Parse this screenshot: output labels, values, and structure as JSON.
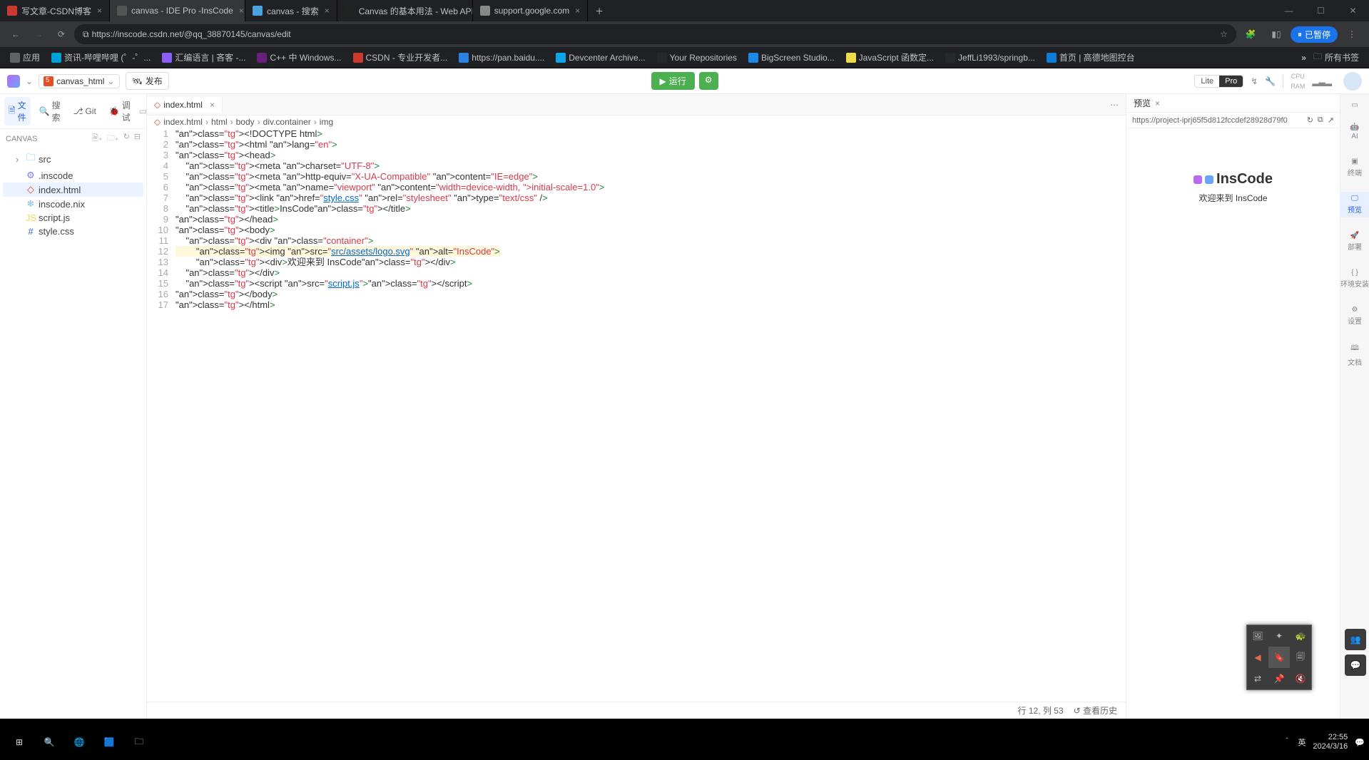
{
  "browser": {
    "tabs": [
      {
        "label": "写文章-CSDN博客",
        "fav": "#cc3a2f"
      },
      {
        "label": "canvas - IDE Pro -InsCode",
        "fav": "#555",
        "active": true
      },
      {
        "label": "canvas - 搜索",
        "fav": "#4aa3df"
      },
      {
        "label": "Canvas 的基本用法 - Web API",
        "fav": "#222"
      },
      {
        "label": "support.google.com",
        "fav": "#888"
      }
    ],
    "url": "https://inscode.csdn.net/@qq_38870145/canvas/edit",
    "pause": "已暂停",
    "bookmarks": [
      {
        "label": "应用",
        "fav": "#5f6368"
      },
      {
        "label": "资讯-哔哩哔哩 (゜-゜...",
        "fav": "#00a1d6"
      },
      {
        "label": "汇编语言 | 吝客 -...",
        "fav": "#8b5cf6"
      },
      {
        "label": "C++ 中 Windows...",
        "fav": "#68217a"
      },
      {
        "label": "CSDN - 专业开发者...",
        "fav": "#cc3a2f"
      },
      {
        "label": "https://pan.baidu....",
        "fav": "#2a82e4"
      },
      {
        "label": "Devcenter Archive...",
        "fav": "#0ea5e9"
      },
      {
        "label": "Your Repositories",
        "fav": "#24292e"
      },
      {
        "label": "BigScreen Studio...",
        "fav": "#1e88e5"
      },
      {
        "label": "JavaScript 函数定...",
        "fav": "#f0db4f"
      },
      {
        "label": "JeffLi1993/springb...",
        "fav": "#24292e"
      },
      {
        "label": "首页 | 高德地图控台",
        "fav": "#0e7dd8"
      }
    ],
    "allbm": "所有书签"
  },
  "ide": {
    "file_chip": "canvas_html",
    "publish": "发布",
    "run": "运行",
    "lite": "Lite",
    "pro": "Pro",
    "cpu": "CPU",
    "ram": "RAM",
    "sidebar": {
      "tabs": {
        "files": "文件",
        "search": "搜索",
        "git": "Git",
        "debug": "调试"
      },
      "head": "CANVAS",
      "tree": [
        {
          "label": "src",
          "type": "folder"
        },
        {
          "label": ".inscode",
          "type": "gear"
        },
        {
          "label": "index.html",
          "type": "html",
          "selected": true
        },
        {
          "label": "inscode.nix",
          "type": "nix"
        },
        {
          "label": "script.js",
          "type": "js"
        },
        {
          "label": "style.css",
          "type": "css"
        }
      ]
    },
    "tabs": {
      "open": "index.html"
    },
    "crumb": [
      "index.html",
      "html",
      "body",
      "div.container",
      "img"
    ],
    "lines": [
      "<!DOCTYPE html>",
      "<html lang=\"en\">",
      "<head>",
      "    <meta charset=\"UTF-8\">",
      "    <meta http-equiv=\"X-UA-Compatible\" content=\"IE=edge\">",
      "    <meta name=\"viewport\" content=\"width=device-width, initial-scale=1.0\">",
      "    <link href=\"style.css\" rel=\"stylesheet\" type=\"text/css\" />",
      "    <title>InsCode</title>",
      "</head>",
      "<body>",
      "    <div class=\"container\">",
      "        <img src=\"src/assets/logo.svg\" alt=\"InsCode\">",
      "        <div>欢迎来到 InsCode</div>",
      "    </div>",
      "    <script src=\"script.js\"></script>",
      "</body>",
      "</html>"
    ],
    "status": {
      "pos": "行 12, 列 53",
      "history": "查看历史"
    },
    "preview": {
      "tab": "预览",
      "url": "https://project-iprj65f5d812fccdef28928d79f0",
      "brand": "InsCode",
      "welcome": "欢迎来到 InsCode"
    },
    "rail": [
      "AI",
      "终端",
      "预览",
      "部署",
      "环境安装",
      "设置",
      "文档"
    ]
  },
  "taskbar": {
    "ime": "英",
    "time": "22:55",
    "date": "2024/3/16"
  }
}
